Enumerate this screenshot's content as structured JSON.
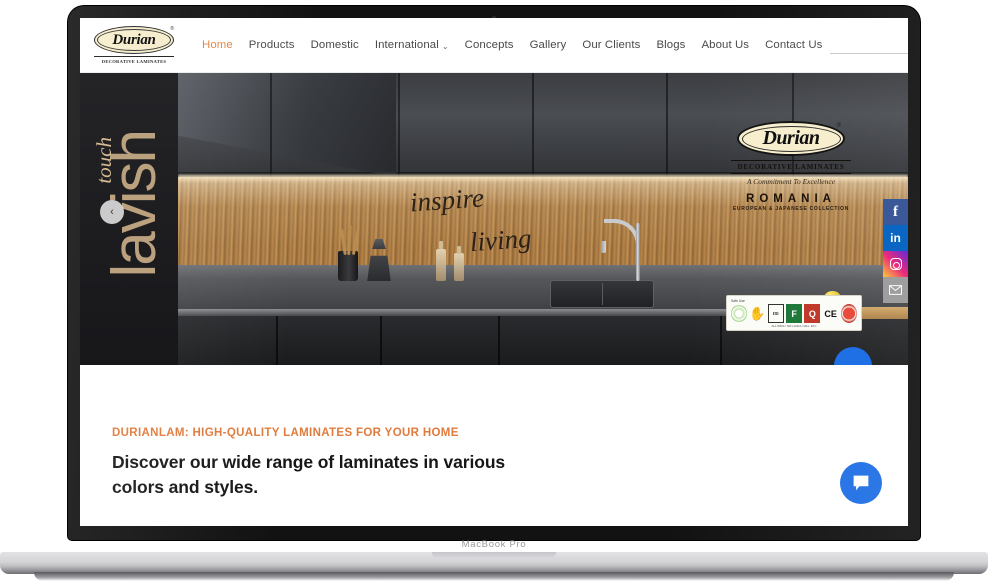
{
  "device": {
    "label": "MacBook Pro"
  },
  "site": {
    "logo": {
      "word": "Durian",
      "registered": "®",
      "subtitle": "DECORATIVE LAMINATES"
    },
    "nav": [
      {
        "label": "Home",
        "active": true,
        "has_caret": false
      },
      {
        "label": "Products",
        "active": false,
        "has_caret": false
      },
      {
        "label": "Domestic",
        "active": false,
        "has_caret": false
      },
      {
        "label": "International",
        "active": false,
        "has_caret": true
      },
      {
        "label": "Concepts",
        "active": false,
        "has_caret": false
      },
      {
        "label": "Gallery",
        "active": false,
        "has_caret": false
      },
      {
        "label": "Our Clients",
        "active": false,
        "has_caret": false
      },
      {
        "label": "Blogs",
        "active": false,
        "has_caret": false
      },
      {
        "label": "About Us",
        "active": false,
        "has_caret": false
      },
      {
        "label": "Contact Us",
        "active": false,
        "has_caret": false
      }
    ],
    "search": {
      "value": "",
      "placeholder": "",
      "icon": "search-icon"
    },
    "active_nav_color": "#e58341"
  },
  "hero": {
    "overlay_text": {
      "vertical_main": "lavish",
      "vertical_script": "touch",
      "script_line1": "inspire",
      "script_line2": "living"
    },
    "brand_badge": {
      "word": "Durian",
      "registered": "®",
      "subtitle": "DECORATIVE LAMINATES",
      "tagline": "A Commitment To Excellence",
      "country": "ROMANIA",
      "collection": "EUROPEAN & JAPANESE COLLECTION"
    },
    "certifications": {
      "top_note": "Safe Use",
      "bottom_note": "ALL INDIA / SRI LANKA / MAL. ETC",
      "items": [
        {
          "name": "greenguard-certificate-icon",
          "text": ""
        },
        {
          "name": "green-hand-eco-icon",
          "text": ""
        },
        {
          "name": "isi-certification-icon",
          "text": "ISI"
        },
        {
          "name": "fsc-certification-icon",
          "text": "F"
        },
        {
          "name": "quality-mark-icon",
          "text": "Q"
        },
        {
          "name": "ce-marking-icon",
          "text": "CE"
        },
        {
          "name": "red-seal-certification-icon",
          "text": ""
        }
      ]
    },
    "carousel": {
      "prev_label": "‹"
    }
  },
  "social_rail": [
    {
      "name": "facebook-icon",
      "glyph": "f",
      "color": "#3b5998"
    },
    {
      "name": "linkedin-icon",
      "glyph": "in",
      "color": "#0a66c2"
    },
    {
      "name": "instagram-icon",
      "glyph": "",
      "color": "#ee2a7b"
    },
    {
      "name": "email-icon",
      "glyph": "✉",
      "color": "#9e9e9e"
    }
  ],
  "promo": {
    "kicker": "DURIANLAM: HIGH-QUALITY LAMINATES FOR YOUR HOME",
    "heading": "Discover our wide range of laminates in various colors and styles.",
    "kicker_color": "#e07b3c"
  },
  "chat_widget": {
    "name": "chat-button",
    "color": "#1f6fe5"
  }
}
